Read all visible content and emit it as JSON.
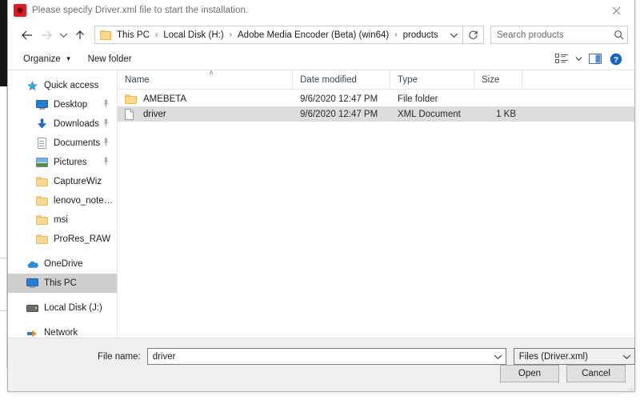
{
  "window": {
    "title": "Please specify Driver.xml file to start the installation.",
    "app_icon": "adobe-media-encoder-icon",
    "close_label": "✕"
  },
  "nav": {
    "back": "back-arrow",
    "forward": "forward-arrow",
    "recent": "recent-locations-chevron",
    "up": "up-arrow",
    "breadcrumbs": [
      {
        "label": "This PC"
      },
      {
        "label": "Local Disk (H:)"
      },
      {
        "label": "Adobe Media Encoder (Beta) (win64)"
      },
      {
        "label": "products"
      }
    ],
    "separator": "›",
    "dropdown_caret": "⌄",
    "refresh_label": "↻",
    "search": {
      "value": "",
      "placeholder": "Search products"
    }
  },
  "commandbar": {
    "organize": "Organize",
    "organize_caret": "▼",
    "new_folder": "New folder",
    "view_icon": "view-options-icon",
    "view_caret": "▼",
    "preview_pane_icon": "preview-pane-icon",
    "help_icon": "help-icon",
    "help_glyph": "?"
  },
  "sidebar": {
    "items": [
      {
        "label": "Quick access",
        "icon": "star-icon",
        "indent": false,
        "pinned": false,
        "selected": false
      },
      {
        "label": "Desktop",
        "icon": "desktop-icon",
        "indent": true,
        "pinned": true,
        "selected": false
      },
      {
        "label": "Downloads",
        "icon": "downloads-icon",
        "indent": true,
        "pinned": true,
        "selected": false
      },
      {
        "label": "Documents",
        "icon": "documents-icon",
        "indent": true,
        "pinned": true,
        "selected": false
      },
      {
        "label": "Pictures",
        "icon": "pictures-icon",
        "indent": true,
        "pinned": true,
        "selected": false
      },
      {
        "label": "CaptureWiz",
        "icon": "folder-icon",
        "indent": true,
        "pinned": false,
        "selected": false
      },
      {
        "label": "lenovo_notebook",
        "icon": "folder-icon",
        "indent": true,
        "pinned": false,
        "selected": false
      },
      {
        "label": "msi",
        "icon": "folder-icon",
        "indent": true,
        "pinned": false,
        "selected": false
      },
      {
        "label": "ProRes_RAW",
        "icon": "folder-icon",
        "indent": true,
        "pinned": false,
        "selected": false
      },
      {
        "label": "OneDrive",
        "icon": "onedrive-cloud-icon",
        "indent": false,
        "pinned": false,
        "selected": false,
        "gap_before": true
      },
      {
        "label": "This PC",
        "icon": "this-pc-icon",
        "indent": false,
        "pinned": false,
        "selected": true
      },
      {
        "label": "Local Disk (J:)",
        "icon": "disk-drive-icon",
        "indent": false,
        "pinned": false,
        "selected": false,
        "gap_before": true
      },
      {
        "label": "Network",
        "icon": "network-icon",
        "indent": false,
        "pinned": false,
        "selected": false,
        "gap_before": true
      }
    ],
    "pin_glyph": "📌"
  },
  "filelist": {
    "columns": [
      "Name",
      "Date modified",
      "Type",
      "Size"
    ],
    "sort_caret": "˄",
    "rows": [
      {
        "name": "AMEBETA",
        "date_modified": "9/6/2020 12:47 PM",
        "type": "File folder",
        "size": "",
        "icon": "folder-icon",
        "selected": false
      },
      {
        "name": "driver",
        "date_modified": "9/6/2020 12:47 PM",
        "type": "XML Document",
        "size": "1 KB",
        "icon": "xml-document-icon",
        "selected": true
      }
    ]
  },
  "footer": {
    "file_name_label": "File name:",
    "file_name_value": "driver",
    "file_name_placeholder": "",
    "file_type_value": "Files (Driver.xml)",
    "combo_arrow": "⌄",
    "open_button": "Open",
    "cancel_button": "Cancel"
  }
}
